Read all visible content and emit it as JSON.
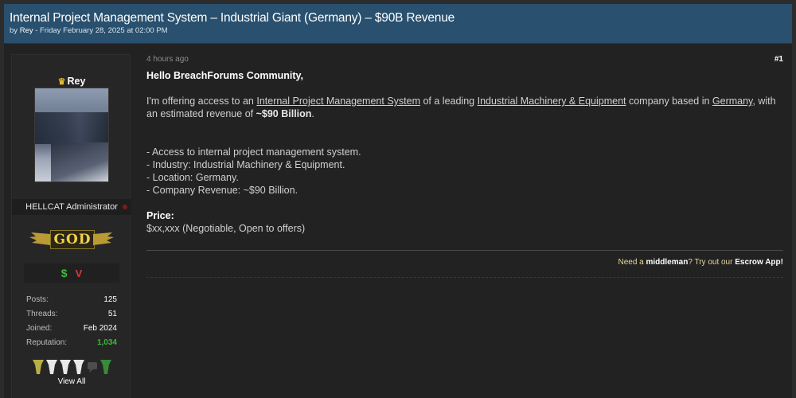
{
  "thread": {
    "title": "Internal Project Management System – Industrial Giant (Germany) – $90B Revenue",
    "byline_prefix": "by ",
    "author": "Rey",
    "byline_date": " - Friday February 28, 2025 at 02:00 PM"
  },
  "user": {
    "username": "Rey",
    "crown_icon": "crown-icon",
    "usertitle": "HELLCAT Administrator",
    "rank_badge": "GOD",
    "award_dollar": "$",
    "award_v": "V",
    "stats": [
      {
        "label": "Posts:",
        "value": "125"
      },
      {
        "label": "Threads:",
        "value": "51"
      },
      {
        "label": "Joined:",
        "value": "Feb 2024"
      },
      {
        "label": "Reputation:",
        "value": "1,034"
      }
    ],
    "reputation_color": "#39b939",
    "view_all": "View All"
  },
  "post": {
    "time": "4 hours ago",
    "number": "#1",
    "greeting": "Hello BreachForums Community,",
    "intro_1": "I'm offering access to an ",
    "link_system": "Internal Project Management System",
    "intro_2": " of a leading ",
    "link_industry": "Industrial Machinery & Equipment",
    "intro_3": " company based in ",
    "link_country": "Germany",
    "intro_4": ", with an estimated revenue of ",
    "revenue_bold": "~$90 Billion",
    "intro_5": ".",
    "bullets": [
      "- Access to internal project management system.",
      "- Industry: Industrial Machinery & Equipment.",
      "- Location: Germany.",
      "- Company Revenue: ~$90 Billion."
    ],
    "price_label": "Price:",
    "price_value": "$xx,xxx (Negotiable, Open to offers)"
  },
  "signature": {
    "prefix": "Need a ",
    "middleman": "middleman",
    "middle": "? Try out our ",
    "escrow": "Escrow App",
    "suffix": "!"
  },
  "colors": {
    "header_bg": "#29506e",
    "page_bg": "#222222",
    "accent_gold": "#f2d046"
  }
}
